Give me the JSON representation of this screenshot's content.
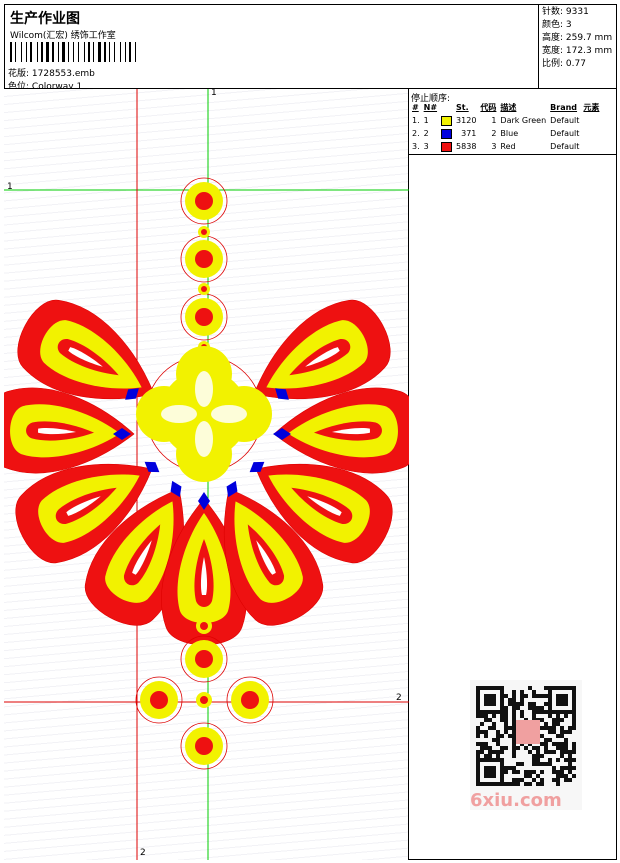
{
  "header": {
    "title": "生产作业图",
    "company": "Wilcom(汇宏) 绣饰工作室",
    "design_label": "花版:",
    "design_file": "1728553.emb",
    "colorway_label": "色位:",
    "colorway": "Colorway 1"
  },
  "specs": [
    {
      "label": "针数:",
      "value": "9331"
    },
    {
      "label": "颜色:",
      "value": "3"
    },
    {
      "label": "高度:",
      "value": "259.7 mm"
    },
    {
      "label": "宽度:",
      "value": "172.3 mm"
    },
    {
      "label": "比例:",
      "value": "0.77"
    }
  ],
  "stop_sequence": {
    "title": "停止顺序:",
    "headers": [
      "#",
      "N#",
      "St.",
      "代码",
      "描述",
      "Brand",
      "元素"
    ],
    "rows": [
      {
        "num": "1.",
        "n": "1",
        "color": "#f2f200",
        "st": "3120",
        "code": "1",
        "desc": "Dark Green",
        "brand": "Default"
      },
      {
        "num": "2.",
        "n": "2",
        "color": "#0000dd",
        "st": "371",
        "code": "2",
        "desc": "Blue",
        "brand": "Default"
      },
      {
        "num": "3.",
        "n": "3",
        "color": "#ee1111",
        "st": "5838",
        "code": "3",
        "desc": "Red",
        "brand": "Default"
      }
    ]
  },
  "registration": {
    "green_v": "1",
    "green_h": "1",
    "red_h": "2",
    "red_v": "2"
  },
  "colors": {
    "yellow": "#f2f200",
    "blue": "#0000dd",
    "red": "#ee1111",
    "green_line": "#00cc00",
    "red_line": "#dd0000"
  },
  "watermark": "6xiu.com"
}
